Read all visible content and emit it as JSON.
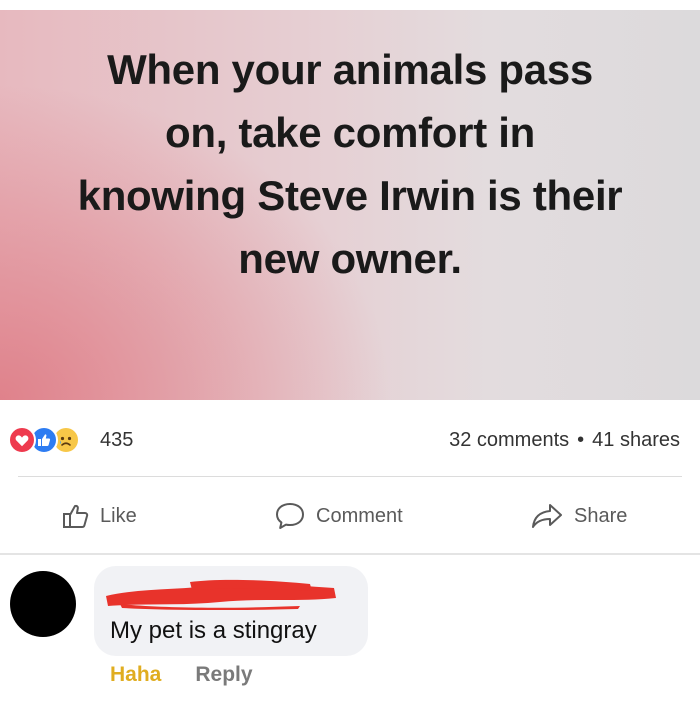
{
  "post": {
    "caption_lines": [
      "When your animals pass",
      "on, take comfort in",
      "knowing Steve Irwin is their",
      "new owner."
    ]
  },
  "reactions": {
    "types": [
      "love-icon",
      "like-icon",
      "sad-icon"
    ],
    "count": "435",
    "comments": "32 comments",
    "separator": "•",
    "shares": "41 shares"
  },
  "actions": {
    "like": "Like",
    "comment": "Comment",
    "share": "Share"
  },
  "comment": {
    "text": "My pet is a stingray",
    "reaction_label": "Haha",
    "reply_label": "Reply"
  },
  "colors": {
    "love": "#ee3a4e",
    "like": "#2d7cf2",
    "sad": "#f7c748",
    "haha_text": "#e0ad20",
    "redaction": "#e8332b"
  }
}
